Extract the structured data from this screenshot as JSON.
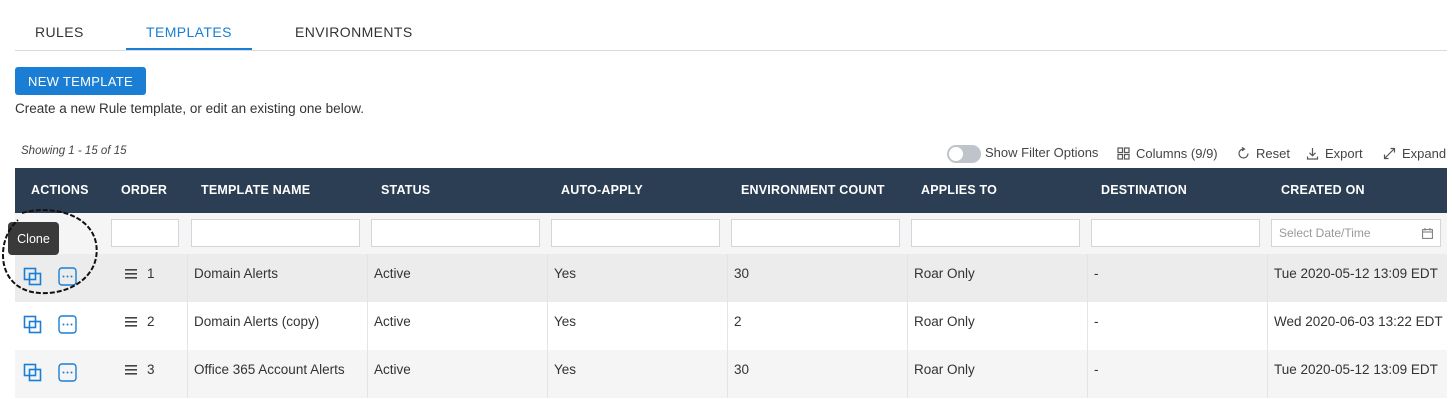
{
  "tabs": [
    {
      "label": "RULES",
      "active": false
    },
    {
      "label": "TEMPLATES",
      "active": true
    },
    {
      "label": "ENVIRONMENTS",
      "active": false
    }
  ],
  "new_template_button": "NEW TEMPLATE",
  "description": "Create a new Rule template, or edit an existing one below.",
  "showing": "Showing 1 - 15 of 15",
  "toolbar": {
    "show_filter": "Show Filter Options",
    "columns": "Columns (9/9)",
    "reset": "Reset",
    "export": "Export",
    "expand": "Expand"
  },
  "columns": [
    "ACTIONS",
    "ORDER",
    "TEMPLATE NAME",
    "STATUS",
    "AUTO-APPLY",
    "ENVIRONMENT COUNT",
    "APPLIES TO",
    "DESTINATION",
    "CREATED ON"
  ],
  "filters": {
    "date_placeholder": "Select Date/Time"
  },
  "tooltip": "Clone",
  "rows": [
    {
      "order": "1",
      "name": "Domain Alerts",
      "status": "Active",
      "auto_apply": "Yes",
      "env_count": "30",
      "applies_to": "Roar Only",
      "destination": "-",
      "created_on": "Tue 2020-05-12 13:09 EDT"
    },
    {
      "order": "2",
      "name": "Domain Alerts (copy)",
      "status": "Active",
      "auto_apply": "Yes",
      "env_count": "2",
      "applies_to": "Roar Only",
      "destination": "-",
      "created_on": "Wed 2020-06-03 13:22 EDT"
    },
    {
      "order": "3",
      "name": "Office 365 Account Alerts",
      "status": "Active",
      "auto_apply": "Yes",
      "env_count": "30",
      "applies_to": "Roar Only",
      "destination": "-",
      "created_on": "Tue 2020-05-12 13:09 EDT"
    }
  ],
  "colors": {
    "accent": "#1a7fd4",
    "header_bg": "#2c3e53"
  }
}
